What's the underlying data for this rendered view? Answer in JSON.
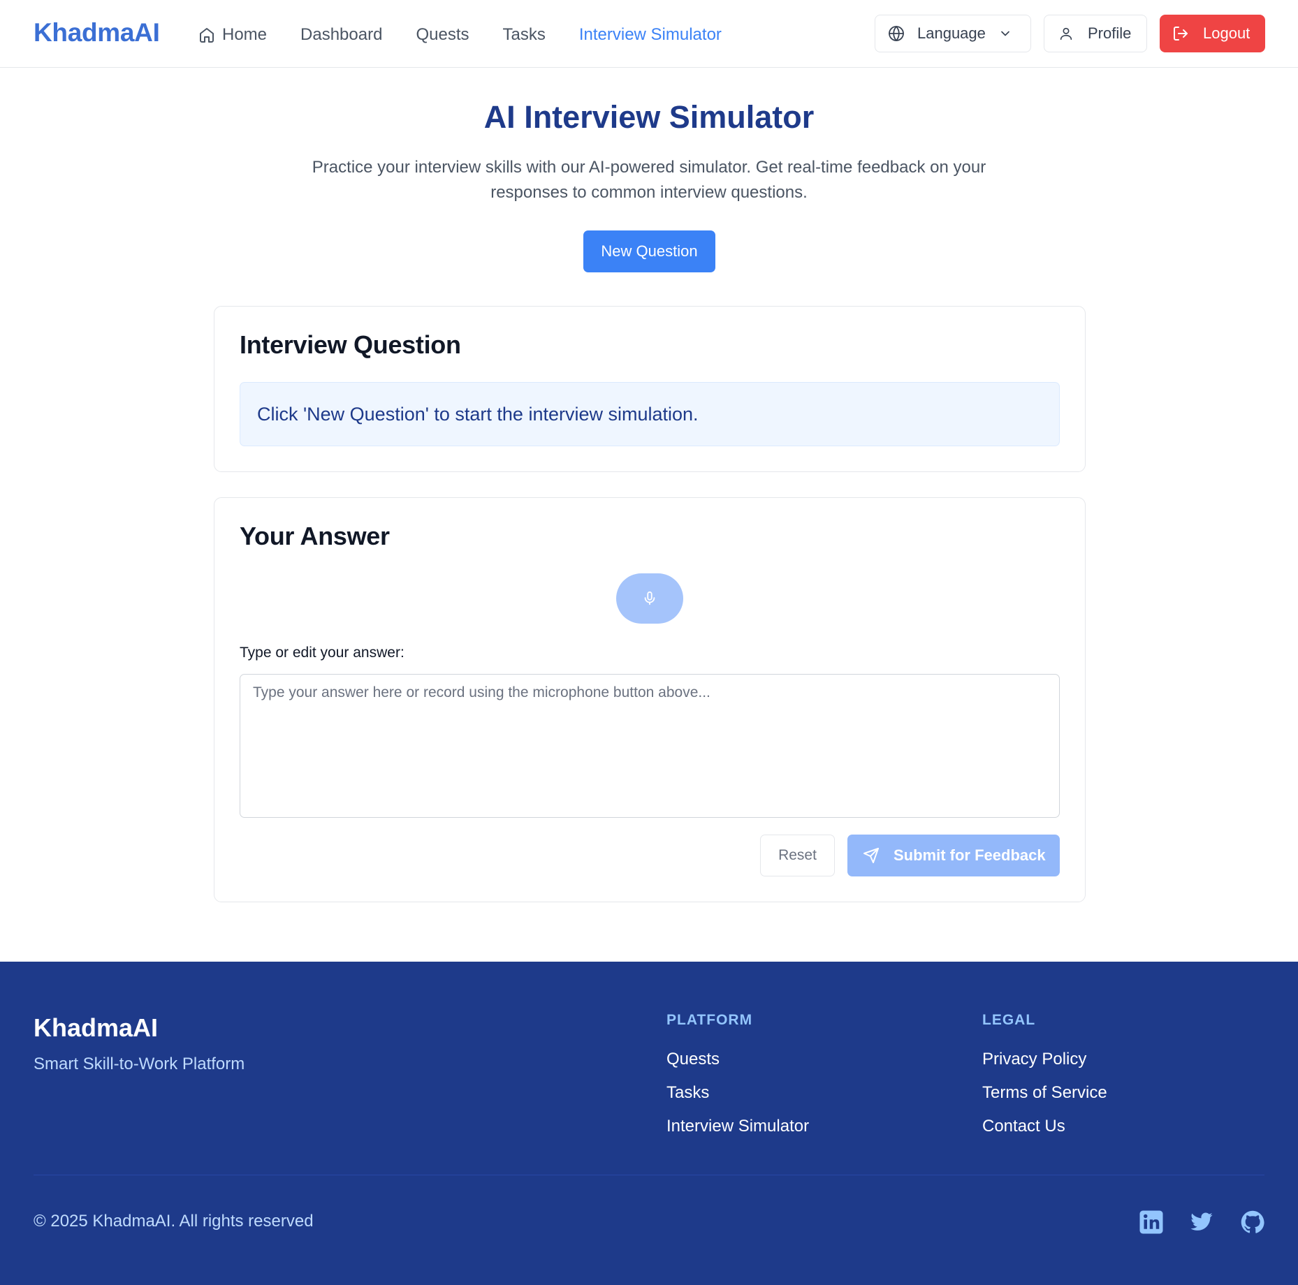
{
  "header": {
    "logo": "KhadmaAI",
    "nav": [
      {
        "label": "Home"
      },
      {
        "label": "Dashboard"
      },
      {
        "label": "Quests"
      },
      {
        "label": "Tasks"
      },
      {
        "label": "Interview Simulator",
        "active": true
      }
    ],
    "language_label": "Language",
    "profile_label": "Profile",
    "logout_label": "Logout"
  },
  "hero": {
    "title": "AI Interview Simulator",
    "description": "Practice your interview skills with our AI-powered simulator. Get real-time feedback on your responses to common interview questions.",
    "new_question_label": "New Question"
  },
  "question_card": {
    "title": "Interview Question",
    "prompt": "Click 'New Question' to start the interview simulation."
  },
  "answer_card": {
    "title": "Your Answer",
    "input_label": "Type or edit your answer:",
    "input_value": "",
    "input_placeholder": "Type your answer here or record using the microphone button above...",
    "reset_label": "Reset",
    "submit_label": "Submit for Feedback"
  },
  "footer": {
    "logo": "KhadmaAI",
    "tagline": "Smart Skill-to-Work Platform",
    "platform": {
      "heading": "PLATFORM",
      "links": [
        "Quests",
        "Tasks",
        "Interview Simulator"
      ]
    },
    "legal": {
      "heading": "LEGAL",
      "links": [
        "Privacy Policy",
        "Terms of Service",
        "Contact Us"
      ]
    },
    "copyright": "© 2025 KhadmaAI. All rights reserved",
    "social_icons": [
      "linkedin-icon",
      "twitter-icon",
      "github-icon"
    ]
  },
  "colors": {
    "brand": "#3b6fd4",
    "primary": "#3b82f6",
    "danger": "#ef4444",
    "footer_bg": "#1e3a8a",
    "title": "#1e3a8a"
  }
}
